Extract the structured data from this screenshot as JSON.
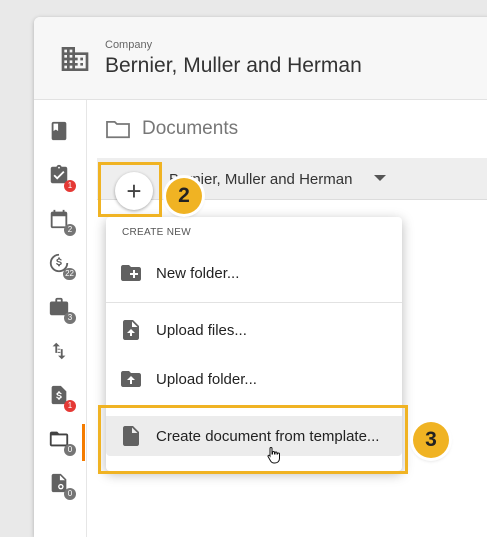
{
  "company": {
    "label": "Company",
    "name": "Bernier, Muller and Herman"
  },
  "sidebar": {
    "items": [
      {
        "icon": "book-icon",
        "badge": ""
      },
      {
        "icon": "clipboard-check-icon",
        "badge": "1",
        "badge_color": "#e53935"
      },
      {
        "icon": "calendar-icon",
        "badge": "2",
        "badge_color": "#757575"
      },
      {
        "icon": "clock-dollar-icon",
        "badge": "22",
        "badge_color": "#757575"
      },
      {
        "icon": "briefcase-icon",
        "badge": "3",
        "badge_color": "#757575"
      },
      {
        "icon": "transfer-icon",
        "badge": ""
      },
      {
        "icon": "invoice-dollar-icon",
        "badge": "1",
        "badge_color": "#e53935"
      },
      {
        "icon": "folder-icon",
        "badge": "0",
        "badge_color": "#757575",
        "active": true
      },
      {
        "icon": "document-settings-icon",
        "badge": "0",
        "badge_color": "#757575"
      }
    ]
  },
  "documents": {
    "title": "Documents",
    "current_folder": "Bernier, Muller and Herman"
  },
  "add_button": {
    "symbol": "+"
  },
  "menu": {
    "header": "CREATE NEW",
    "items": [
      {
        "icon": "new-folder-icon",
        "label": "New folder..."
      },
      {
        "icon": "upload-file-icon",
        "label": "Upload files..."
      },
      {
        "icon": "upload-folder-icon",
        "label": "Upload folder..."
      },
      {
        "icon": "document-icon",
        "label": "Create document from template..."
      }
    ]
  },
  "steps": {
    "step2": "2",
    "step3": "3"
  },
  "colors": {
    "highlight": "#f0b323",
    "active_accent": "#f57c00",
    "badge_red": "#e53935",
    "badge_grey": "#757575"
  }
}
